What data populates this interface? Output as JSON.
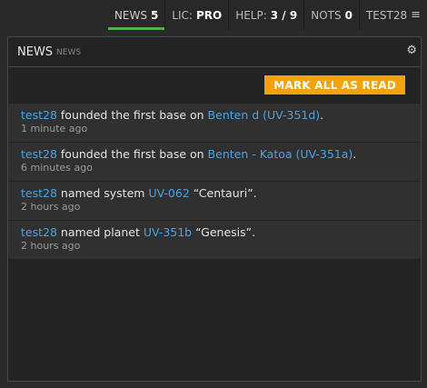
{
  "topnav": {
    "news_label": "NEWS",
    "news_count": "5",
    "lic_label": "LIC:",
    "lic_value": "PRO",
    "help_label": "HELP:",
    "help_value": "3 / 9",
    "nots_label": "NOTS",
    "nots_count": "0",
    "user": "TEST28",
    "menu_icon": "≡"
  },
  "panel": {
    "title": "NEWS",
    "subtitle": "NEWS",
    "gear_icon": "⚙",
    "mark_all_label": "MARK ALL AS READ"
  },
  "news": [
    {
      "user": "test28",
      "action": "founded the first base on",
      "target": "Benten d (UV-351d)",
      "suffix": ".",
      "time": "1 minute ago"
    },
    {
      "user": "test28",
      "action": "founded the first base on",
      "target": "Benten - Katoa (UV-351a)",
      "suffix": ".",
      "time": "6 minutes ago"
    },
    {
      "user": "test28",
      "action": "named system",
      "target": "UV-062",
      "suffix": "“Centauri”.",
      "time": "2 hours ago"
    },
    {
      "user": "test28",
      "action": "named planet",
      "target": "UV-351b",
      "suffix": "“Genesis”.",
      "time": "2 hours ago"
    }
  ],
  "colors": {
    "accent_active": "#4fae4f",
    "button": "#f5a20a",
    "link": "#4aa3e0"
  }
}
